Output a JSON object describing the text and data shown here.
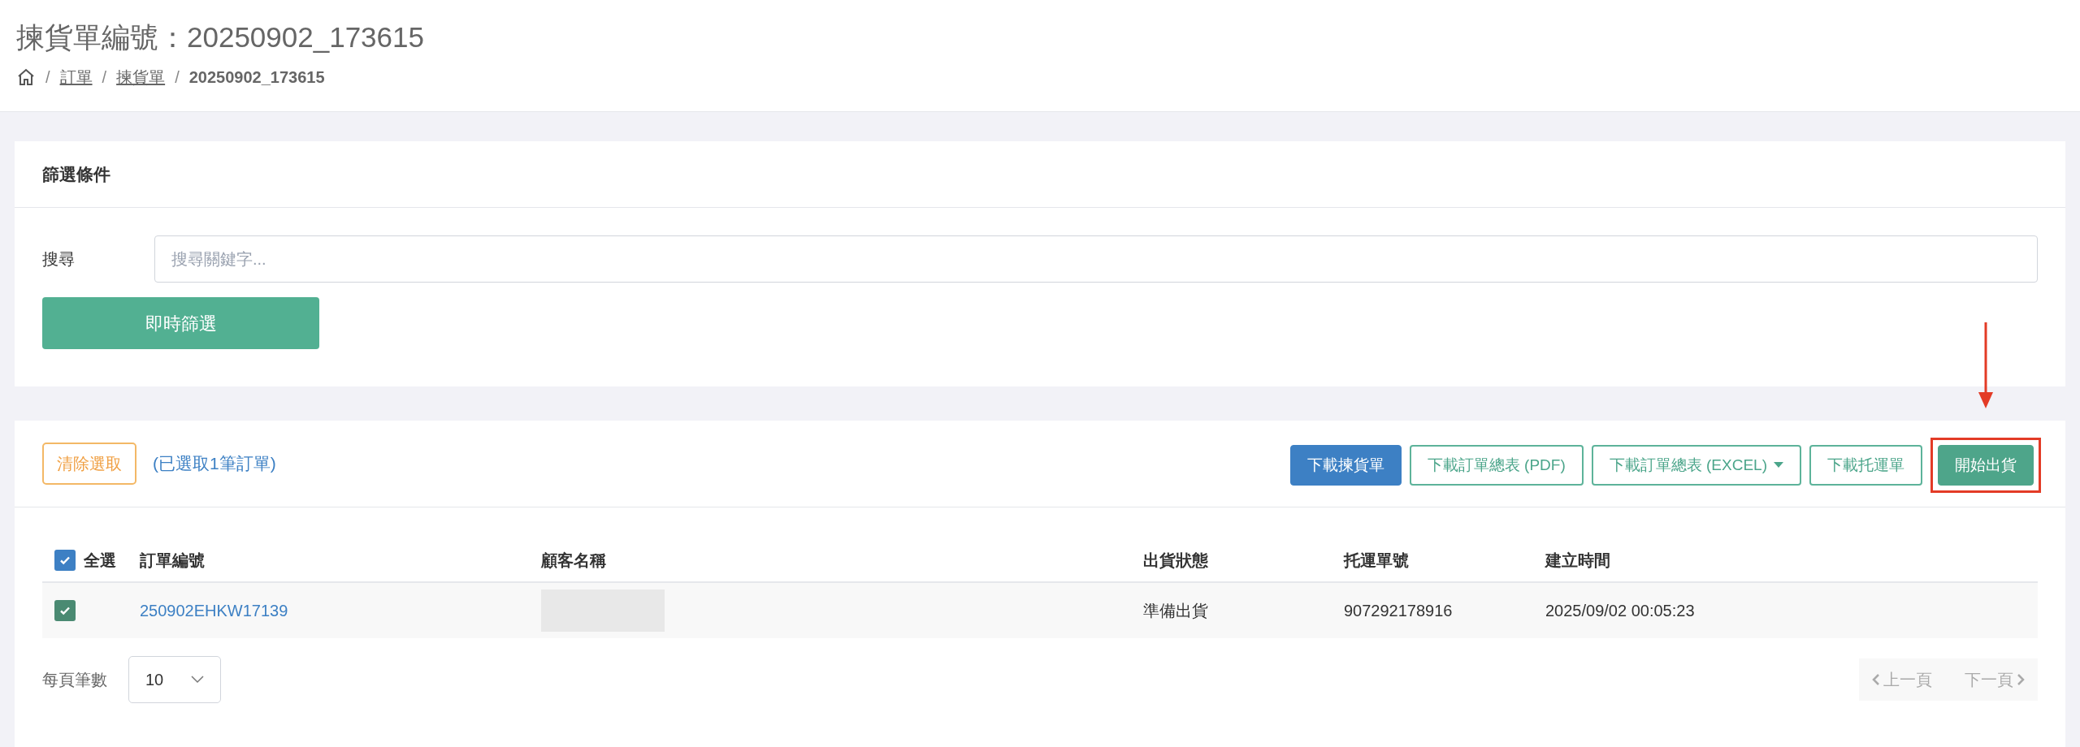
{
  "page": {
    "title": "揀貨單編號：20250902_173615",
    "breadcrumb": [
      {
        "separator": "/",
        "label": "訂單",
        "link": true
      },
      {
        "separator": "/",
        "label": "揀貨單",
        "link": true
      },
      {
        "separator": "/",
        "label": "20250902_173615",
        "link": false
      }
    ]
  },
  "filter": {
    "title": "篩選條件",
    "search_label": "搜尋",
    "placeholder": "搜尋關鍵字...",
    "button": "即時篩選"
  },
  "toolbar": {
    "clear_button": "清除選取",
    "selection_note": "(已選取1筆訂單)",
    "buttons": [
      {
        "label": "下載揀貨單",
        "kind": "primary",
        "dropdown": false
      },
      {
        "label": "下載訂單總表 (PDF)",
        "kind": "outline",
        "dropdown": false
      },
      {
        "label": "下載訂單總表 (EXCEL)",
        "kind": "outline",
        "dropdown": true
      },
      {
        "label": "下載托運單",
        "kind": "outline",
        "dropdown": false
      },
      {
        "label": "開始出貨",
        "kind": "success",
        "dropdown": false,
        "highlighted": true
      }
    ]
  },
  "table": {
    "select_all": {
      "label": "全選",
      "checked": true
    },
    "columns": [
      "訂單編號",
      "顧客名稱",
      "出貨狀態",
      "托運單號",
      "建立時間"
    ],
    "rows": [
      {
        "checked": true,
        "order_no": "250902EHKW17139",
        "customer_hidden": true,
        "status": "準備出貨",
        "tracking_no": "907292178916",
        "created": "2025/09/02 00:05:23"
      }
    ]
  },
  "footer": {
    "per_page_label": "每頁筆數",
    "per_page": "10",
    "prev": "上一頁",
    "next": "下一頁"
  }
}
